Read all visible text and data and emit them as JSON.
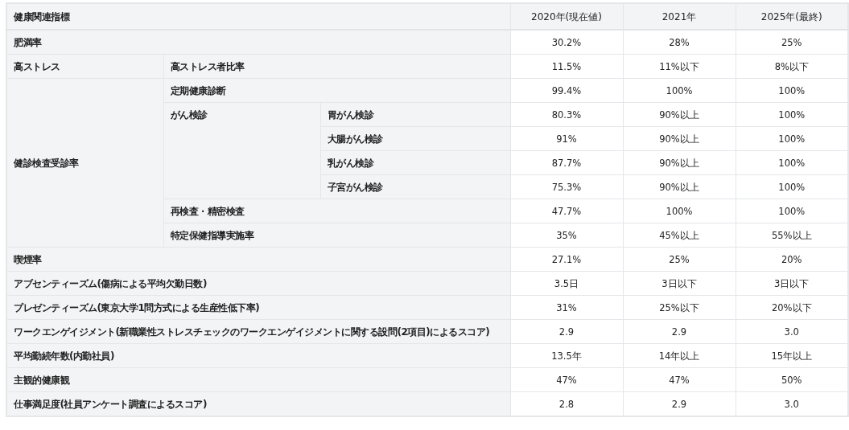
{
  "table": {
    "columns": [
      "健康関連指標",
      "2020年(現在値)",
      "2021年",
      "2025年(最終)"
    ],
    "rows": [
      {
        "label": "肥満率",
        "values": [
          "30.2%",
          "28%",
          "25%"
        ]
      },
      {
        "label": "高ストレス",
        "children": [
          {
            "label": "高ストレス者比率",
            "values": [
              "11.5%",
              "11%以下",
              "8%以下"
            ]
          }
        ]
      },
      {
        "label": "健診検査受診率",
        "children": [
          {
            "label": "定期健康診断",
            "values": [
              "99.4%",
              "100%",
              "100%"
            ]
          },
          {
            "label": "がん検診",
            "children": [
              {
                "label": "胃がん検診",
                "values": [
                  "80.3%",
                  "90%以上",
                  "100%"
                ]
              },
              {
                "label": "大腸がん検診",
                "values": [
                  "91%",
                  "90%以上",
                  "100%"
                ]
              },
              {
                "label": "乳がん検診",
                "values": [
                  "87.7%",
                  "90%以上",
                  "100%"
                ]
              },
              {
                "label": "子宮がん検診",
                "values": [
                  "75.3%",
                  "90%以上",
                  "100%"
                ]
              }
            ]
          },
          {
            "label": "再検査・精密検査",
            "values": [
              "47.7%",
              "100%",
              "100%"
            ]
          },
          {
            "label": "特定保健指導実施率",
            "values": [
              "35%",
              "45%以上",
              "55%以上"
            ]
          }
        ]
      },
      {
        "label": "喫煙率",
        "values": [
          "27.1%",
          "25%",
          "20%"
        ]
      },
      {
        "label": "アブセンティーズム(傷病による平均欠勤日数)",
        "values": [
          "3.5日",
          "3日以下",
          "3日以下"
        ]
      },
      {
        "label": "プレゼンティーズム(東京大学1問方式による生産性低下率)",
        "values": [
          "31%",
          "25%以下",
          "20%以下"
        ]
      },
      {
        "label": "ワークエンゲイジメント(新職業性ストレスチェックのワークエンゲイジメントに関する設問(2項目)によるスコア)",
        "values": [
          "2.9",
          "2.9",
          "3.0"
        ]
      },
      {
        "label": "平均勤続年数(内勤社員)",
        "values": [
          "13.5年",
          "14年以上",
          "15年以上"
        ]
      },
      {
        "label": "主観的健康観",
        "values": [
          "47%",
          "47%",
          "50%"
        ]
      },
      {
        "label": "仕事満足度(社員アンケート調査によるスコア)",
        "values": [
          "2.8",
          "2.9",
          "3.0"
        ]
      }
    ]
  }
}
